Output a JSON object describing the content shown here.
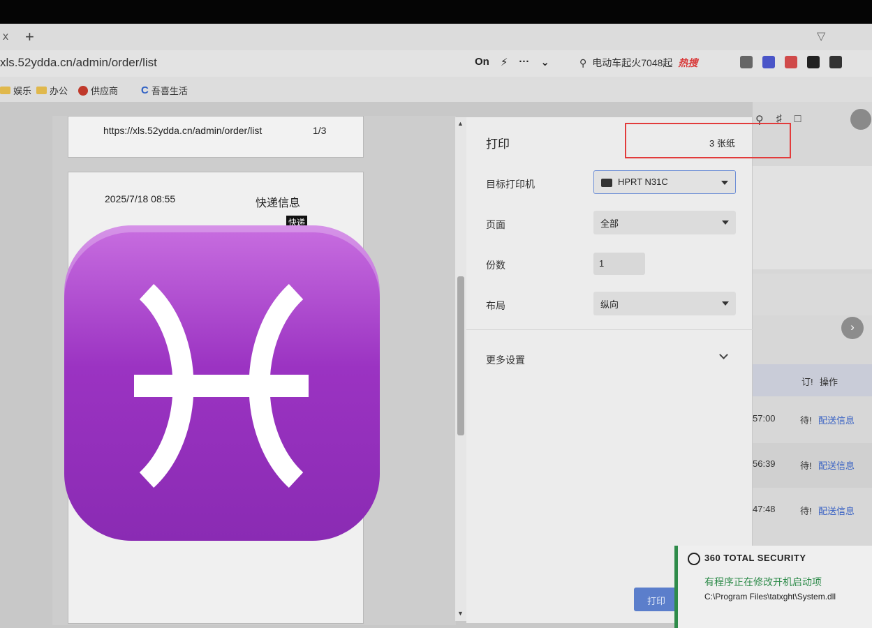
{
  "browser": {
    "tab_close": "x",
    "new_tab": "+",
    "url": "xls.52ydda.cn/admin/order/list",
    "addr_icons": [
      "On",
      "⚡",
      "···",
      "⌄"
    ],
    "search_text": "电动车起火7048起",
    "hot_label": "热搜",
    "bookmarks": [
      "娱乐",
      "办公",
      "供应商",
      "吾喜生活"
    ]
  },
  "preview": {
    "sheet1_url": "https://xls.52ydda.cn/admin/order/list",
    "sheet1_page": "1/3",
    "sheet2_date": "2025/7/18 08:55",
    "sheet2_title": "快递信息",
    "sheet2_tag": "快递"
  },
  "print_dialog": {
    "title": "打印",
    "sheet_count": "3 张纸",
    "printer_label": "目标打印机",
    "printer_value": "HPRT N31C",
    "pages_label": "页面",
    "pages_value": "全部",
    "copies_label": "份数",
    "copies_value": "1",
    "layout_label": "布局",
    "layout_value": "纵向",
    "more_settings": "更多设置",
    "print_button": "打印"
  },
  "background_table": {
    "col_order": "订!",
    "col_ops": "操作",
    "rows": [
      {
        "time": "57:00",
        "status": "待!",
        "link": "配送信息"
      },
      {
        "time": "56:39",
        "status": "待!",
        "link": "配送信息"
      },
      {
        "time": "47:48",
        "status": "待!",
        "link": "配送信息"
      }
    ]
  },
  "security_popup": {
    "brand": "360 TOTAL SECURITY",
    "message": "有程序正在修改开机启动项",
    "path": "C:\\Program Files\\tatxght\\System.dll"
  },
  "overlay": {
    "emoji": "pisces-emoji"
  },
  "colors": {
    "highlight_box": "#e23b3b",
    "emoji_purple": "#9b33c2",
    "security_green": "#2e8b4a",
    "link_blue": "#3a63c4"
  }
}
